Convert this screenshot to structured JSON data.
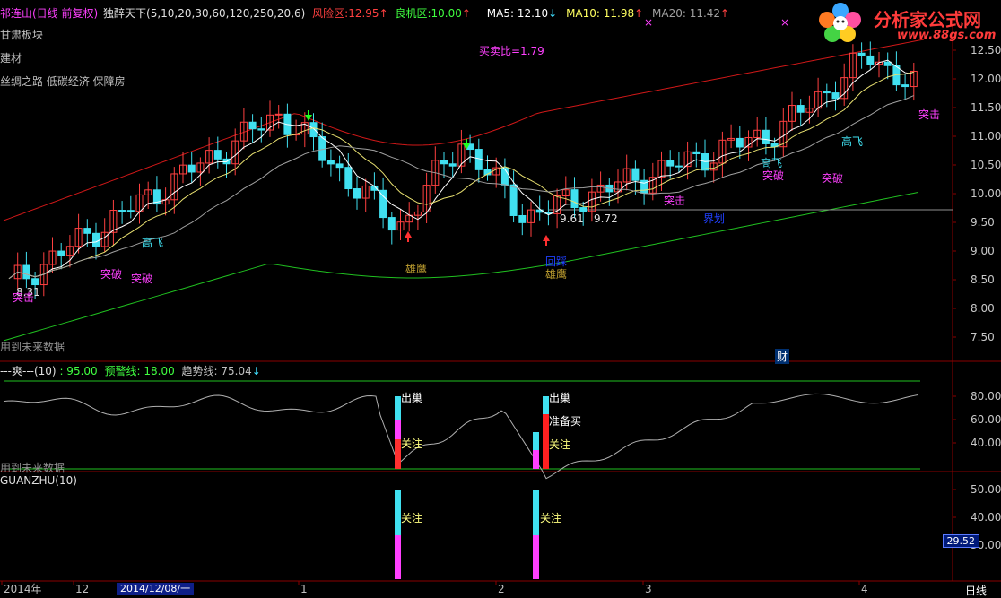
{
  "header": {
    "stock_title": "祁连山(日线 前复权)",
    "formula_name": "独醉天下(5,10,20,30,60,120,250,20,6)",
    "risk_label": "风险区:",
    "risk_value": "12.95",
    "opportunity_label": "良机区:",
    "opportunity_value": "10.00",
    "ma5_label": "MA5: 12.10",
    "ma10_label": "MA10: 11.98",
    "ma20_label": "MA20: 11.42",
    "up_arrow": "↑",
    "down_arrow": "↓"
  },
  "sectors": [
    "甘肃板块",
    "建材",
    "丝绸之路 低碳经济 保障房"
  ],
  "main_chart": {
    "buy_sell_ratio": "买卖比=1.79",
    "y_ticks": [
      "12.50",
      "12.00",
      "11.50",
      "11.00",
      "10.50",
      "10.00",
      "9.50",
      "9.00",
      "8.50",
      "8.00",
      "7.50"
    ],
    "annotations": [
      "8.31",
      "突击",
      "突破",
      "突破",
      "高飞",
      "雄鹰",
      "9.61",
      "9.72",
      "突击",
      "回踩",
      "雄鹰",
      "界划",
      "高飞",
      "突破",
      "突破",
      "高飞",
      "突击"
    ],
    "future_data_note": "用到未来数据",
    "finance_marker": "财"
  },
  "indicator1": {
    "name": "---爽---(10)",
    "value": ": 95.00",
    "warning_line": "预警线: 18.00",
    "trend_line": "趋势线: 75.04",
    "trend_arrow": "↓",
    "y_ticks": [
      "80.00",
      "60.00",
      "40.00"
    ],
    "labels": [
      "出巢",
      "关注",
      "出巢",
      "准备买",
      "关注"
    ],
    "future_data_note": "用到未来数据"
  },
  "indicator2": {
    "name": "GUANZHU(10)",
    "y_ticks": [
      "50.00",
      "40.00",
      "30.00"
    ],
    "labels": [
      "关注",
      "关注"
    ],
    "current_value": "29.52"
  },
  "time_axis": {
    "labels": [
      "2014年",
      "12",
      "2014/12/08/一",
      "1",
      "2",
      "3",
      "4"
    ],
    "period": "日线"
  },
  "logo": {
    "text": "分析家公式网",
    "url": "www.88gs.com"
  },
  "colors": {
    "up": "#ff4040",
    "down": "#40e0f0",
    "ma_white": "#ffffff",
    "ma_yellow": "#e8e070",
    "ma_gray": "#a0a0a0",
    "band_red": "#d01818",
    "band_green": "#20c020",
    "magenta": "#ff40ff",
    "grid_red": "#8a0000"
  }
}
